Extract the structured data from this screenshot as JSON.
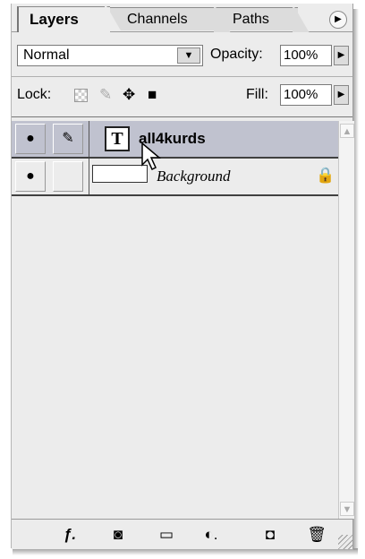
{
  "tabs": [
    {
      "label": "Layers"
    },
    {
      "label": "Channels"
    },
    {
      "label": "Paths"
    }
  ],
  "panel_menu_icon": "play-right-icon",
  "blend_mode": {
    "value": "Normal"
  },
  "opacity": {
    "label": "Opacity:",
    "value": "100%"
  },
  "lock": {
    "label": "Lock:"
  },
  "fill": {
    "label": "Fill:",
    "value": "100%"
  },
  "layers": [
    {
      "name": "all4kurds",
      "type": "text",
      "visible": true,
      "selected": true,
      "thumb_glyph": "T"
    },
    {
      "name": "Background",
      "type": "background",
      "visible": true,
      "selected": false,
      "locked": true
    }
  ],
  "bottom_icons": [
    "link-layers-icon",
    "layer-mask-icon",
    "new-group-icon",
    "adjustment-layer-icon",
    "new-layer-icon",
    "trash-icon"
  ],
  "colors": {
    "panel": "#ececec",
    "selected_row": "#c0c2cf"
  }
}
